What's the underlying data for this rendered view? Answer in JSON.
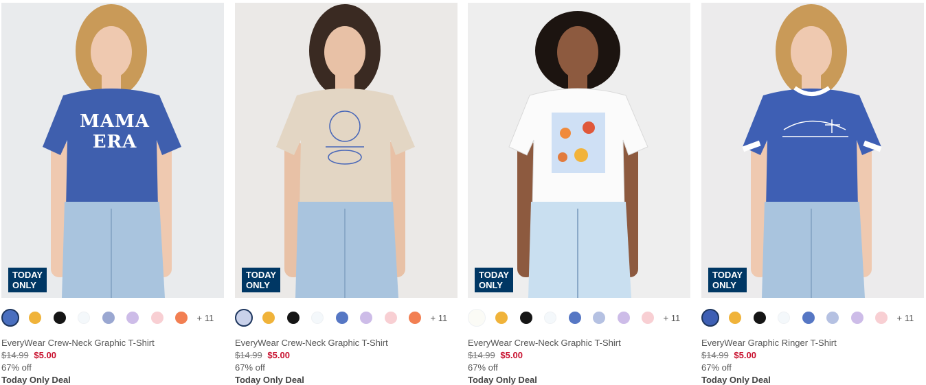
{
  "products": [
    {
      "name": "EveryWear Crew-Neck Graphic T-Shirt",
      "old_price": "$14.99",
      "new_price": "$5.00",
      "discount": "67% off",
      "deal": "Today Only Deal",
      "badge_line1": "TODAY",
      "badge_line2": "ONLY",
      "more_colors": "+ 11",
      "shirt_print": "MAMA ERA",
      "shirt_color": "#3f5fae",
      "swatches": [
        "#4a6fbf",
        "#f0b33a",
        "#151515",
        "#f4f8fb",
        "#9aa7d1",
        "#cdbce8",
        "#f8cfd3",
        "#f27f52"
      ]
    },
    {
      "name": "EveryWear Crew-Neck Graphic T-Shirt",
      "old_price": "$14.99",
      "new_price": "$5.00",
      "discount": "67% off",
      "deal": "Today Only Deal",
      "badge_line1": "TODAY",
      "badge_line2": "ONLY",
      "more_colors": "+ 11",
      "shirt_print": "",
      "shirt_color": "#e3d6c4",
      "swatches": [
        "#c9d1ea",
        "#f0b33a",
        "#151515",
        "#f4f8fb",
        "#5677c4",
        "#cdbce8",
        "#f8cfd3",
        "#f27f52"
      ]
    },
    {
      "name": "EveryWear Crew-Neck Graphic T-Shirt",
      "old_price": "$14.99",
      "new_price": "$5.00",
      "discount": "67% off",
      "deal": "Today Only Deal",
      "badge_line1": "TODAY",
      "badge_line2": "ONLY",
      "more_colors": "+ 11",
      "shirt_print": "",
      "shirt_color": "#fbfbfb",
      "swatches": [
        "#fbfbf6",
        "#f0b33a",
        "#151515",
        "#f4f8fb",
        "#5677c4",
        "#b5c1e2",
        "#cdbce8",
        "#f8cfd3"
      ]
    },
    {
      "name": "EveryWear Graphic Ringer T-Shirt",
      "old_price": "$14.99",
      "new_price": "$5.00",
      "discount": "67% off",
      "deal": "Today Only Deal",
      "badge_line1": "TODAY",
      "badge_line2": "ONLY",
      "more_colors": "+ 11",
      "shirt_print": "",
      "shirt_color": "#3e5fb4",
      "swatches": [
        "#3e5fb4",
        "#f0b33a",
        "#151515",
        "#f4f8fb",
        "#5677c4",
        "#b5c1e2",
        "#cdbce8",
        "#f8cfd3"
      ]
    }
  ]
}
